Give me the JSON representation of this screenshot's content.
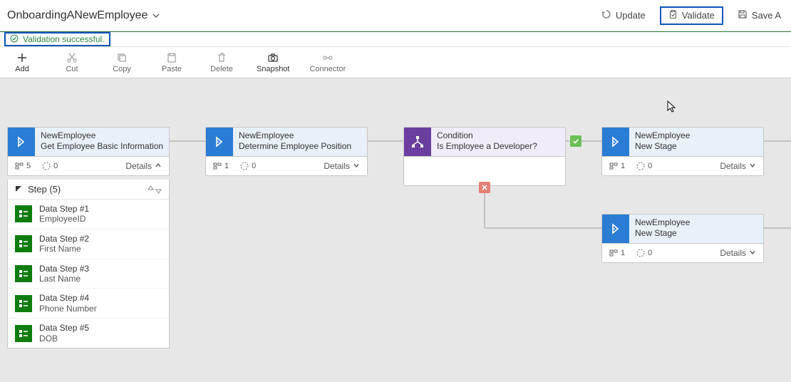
{
  "header": {
    "title": "OnboardingANewEmployee",
    "actions": {
      "update": "Update",
      "validate": "Validate",
      "save": "Save A"
    }
  },
  "notification": "Validation successful.",
  "toolbar": {
    "add": "Add",
    "cut": "Cut",
    "copy": "Copy",
    "paste": "Paste",
    "delete": "Delete",
    "snapshot": "Snapshot",
    "connector": "Connector"
  },
  "stages": [
    {
      "entity": "NewEmployee",
      "title": "Get Employee Basic Information",
      "steps_count": "5",
      "duration": "0",
      "details_label": "Details",
      "expanded": true
    },
    {
      "entity": "NewEmployee",
      "title": "Determine Employee Position",
      "steps_count": "1",
      "duration": "0",
      "details_label": "Details"
    },
    {
      "entity": "Condition",
      "title": "Is Employee a Developer?",
      "is_condition": true
    },
    {
      "entity": "NewEmployee",
      "title": "New Stage",
      "steps_count": "1",
      "duration": "0",
      "details_label": "Details"
    },
    {
      "entity": "NewEmployee",
      "title": "New Stage",
      "steps_count": "1",
      "duration": "0",
      "details_label": "Details"
    }
  ],
  "step_panel": {
    "header": "Step (5)",
    "items": [
      {
        "name": "Data Step #1",
        "field": "EmployeeID"
      },
      {
        "name": "Data Step #2",
        "field": "First Name"
      },
      {
        "name": "Data Step #3",
        "field": "Last Name"
      },
      {
        "name": "Data Step #4",
        "field": "Phone Number"
      },
      {
        "name": "Data Step #5",
        "field": "DOB"
      }
    ]
  }
}
